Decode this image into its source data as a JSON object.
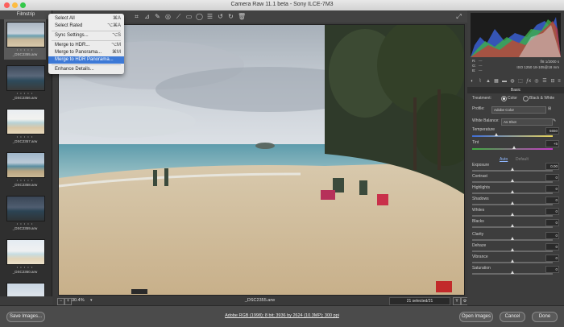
{
  "window": {
    "title": "Camera Raw 11.1 beta  -  Sony ILCE-7M3"
  },
  "filmstrip": {
    "header": "Filmstrip",
    "items": [
      {
        "name": "_DSC2355.arw",
        "stars": "• • • • •"
      },
      {
        "name": "_DSC2356.arw",
        "stars": "• • • • •"
      },
      {
        "name": "_DSC2357.arw",
        "stars": "• • • • •"
      },
      {
        "name": "_DSC2358.arw",
        "stars": "• • • • •"
      },
      {
        "name": "_DSC2359.arw",
        "stars": "• • • • •"
      },
      {
        "name": "_DSC2360.arw",
        "stars": "• • • • •"
      },
      {
        "name": "",
        "stars": ""
      }
    ]
  },
  "menu": {
    "items": [
      {
        "label": "Select All",
        "shortcut": "⌘A"
      },
      {
        "label": "Select Rated",
        "shortcut": "⌥⌘A"
      },
      {
        "label": "Sync Settings...",
        "shortcut": "⌥S"
      },
      {
        "label": "Merge to HDR...",
        "shortcut": "⌥M"
      },
      {
        "label": "Merge to Panorama...",
        "shortcut": "⌘M"
      },
      {
        "label": "Merge to HDR Panorama...",
        "shortcut": ""
      },
      {
        "label": "Enhance Details...",
        "shortcut": ""
      }
    ],
    "highlighted_index": 5
  },
  "status": {
    "zoom_value": "30.4%",
    "filename": "_DSC2355.arw",
    "selected_count": "21 selected/21"
  },
  "bottom": {
    "save_images": "Save Images...",
    "info_link": "Adobe RGB (1998); 8 bit; 3936 by 2624 (10.3MP); 300 ppi",
    "open_images": "Open Images",
    "cancel": "Cancel",
    "done": "Done"
  },
  "camera_info": {
    "r_label": "R:",
    "g_label": "G:",
    "b_label": "B:",
    "r_val": "---",
    "g_val": "---",
    "b_val": "---",
    "aperture_shutter": "f/8   1/2000 s",
    "iso_lens": "ISO 1250   18-105@18 mm"
  },
  "basic": {
    "panel_title": "Basic",
    "treatment_label": "Treatment:",
    "treatment_color": "Color",
    "treatment_bw": "Black & White",
    "profile_label": "Profile:",
    "profile_value": "Adobe Color",
    "wb_label": "White Balance:",
    "wb_value": "As Shot",
    "sliders": [
      {
        "label": "Temperature",
        "value": "5650",
        "position": 0.3
      },
      {
        "label": "Tint",
        "value": "+5",
        "position": 0.52
      }
    ],
    "auto": "Auto",
    "default": "Default",
    "tone": [
      {
        "label": "Exposure",
        "value": "0.00",
        "position": 0.5
      },
      {
        "label": "Contrast",
        "value": "0",
        "position": 0.5
      },
      {
        "label": "Highlights",
        "value": "0",
        "position": 0.5
      },
      {
        "label": "Shadows",
        "value": "0",
        "position": 0.5
      },
      {
        "label": "Whites",
        "value": "0",
        "position": 0.5
      },
      {
        "label": "Blacks",
        "value": "0",
        "position": 0.5
      }
    ],
    "presence": [
      {
        "label": "Clarity",
        "value": "0",
        "position": 0.5
      },
      {
        "label": "Dehaze",
        "value": "0",
        "position": 0.5
      },
      {
        "label": "Vibrance",
        "value": "0",
        "position": 0.5
      },
      {
        "label": "Saturation",
        "value": "0",
        "position": 0.5
      }
    ]
  },
  "colors": {
    "menu_highlight": "#3d79d6",
    "accent_green": "#4caf50"
  }
}
